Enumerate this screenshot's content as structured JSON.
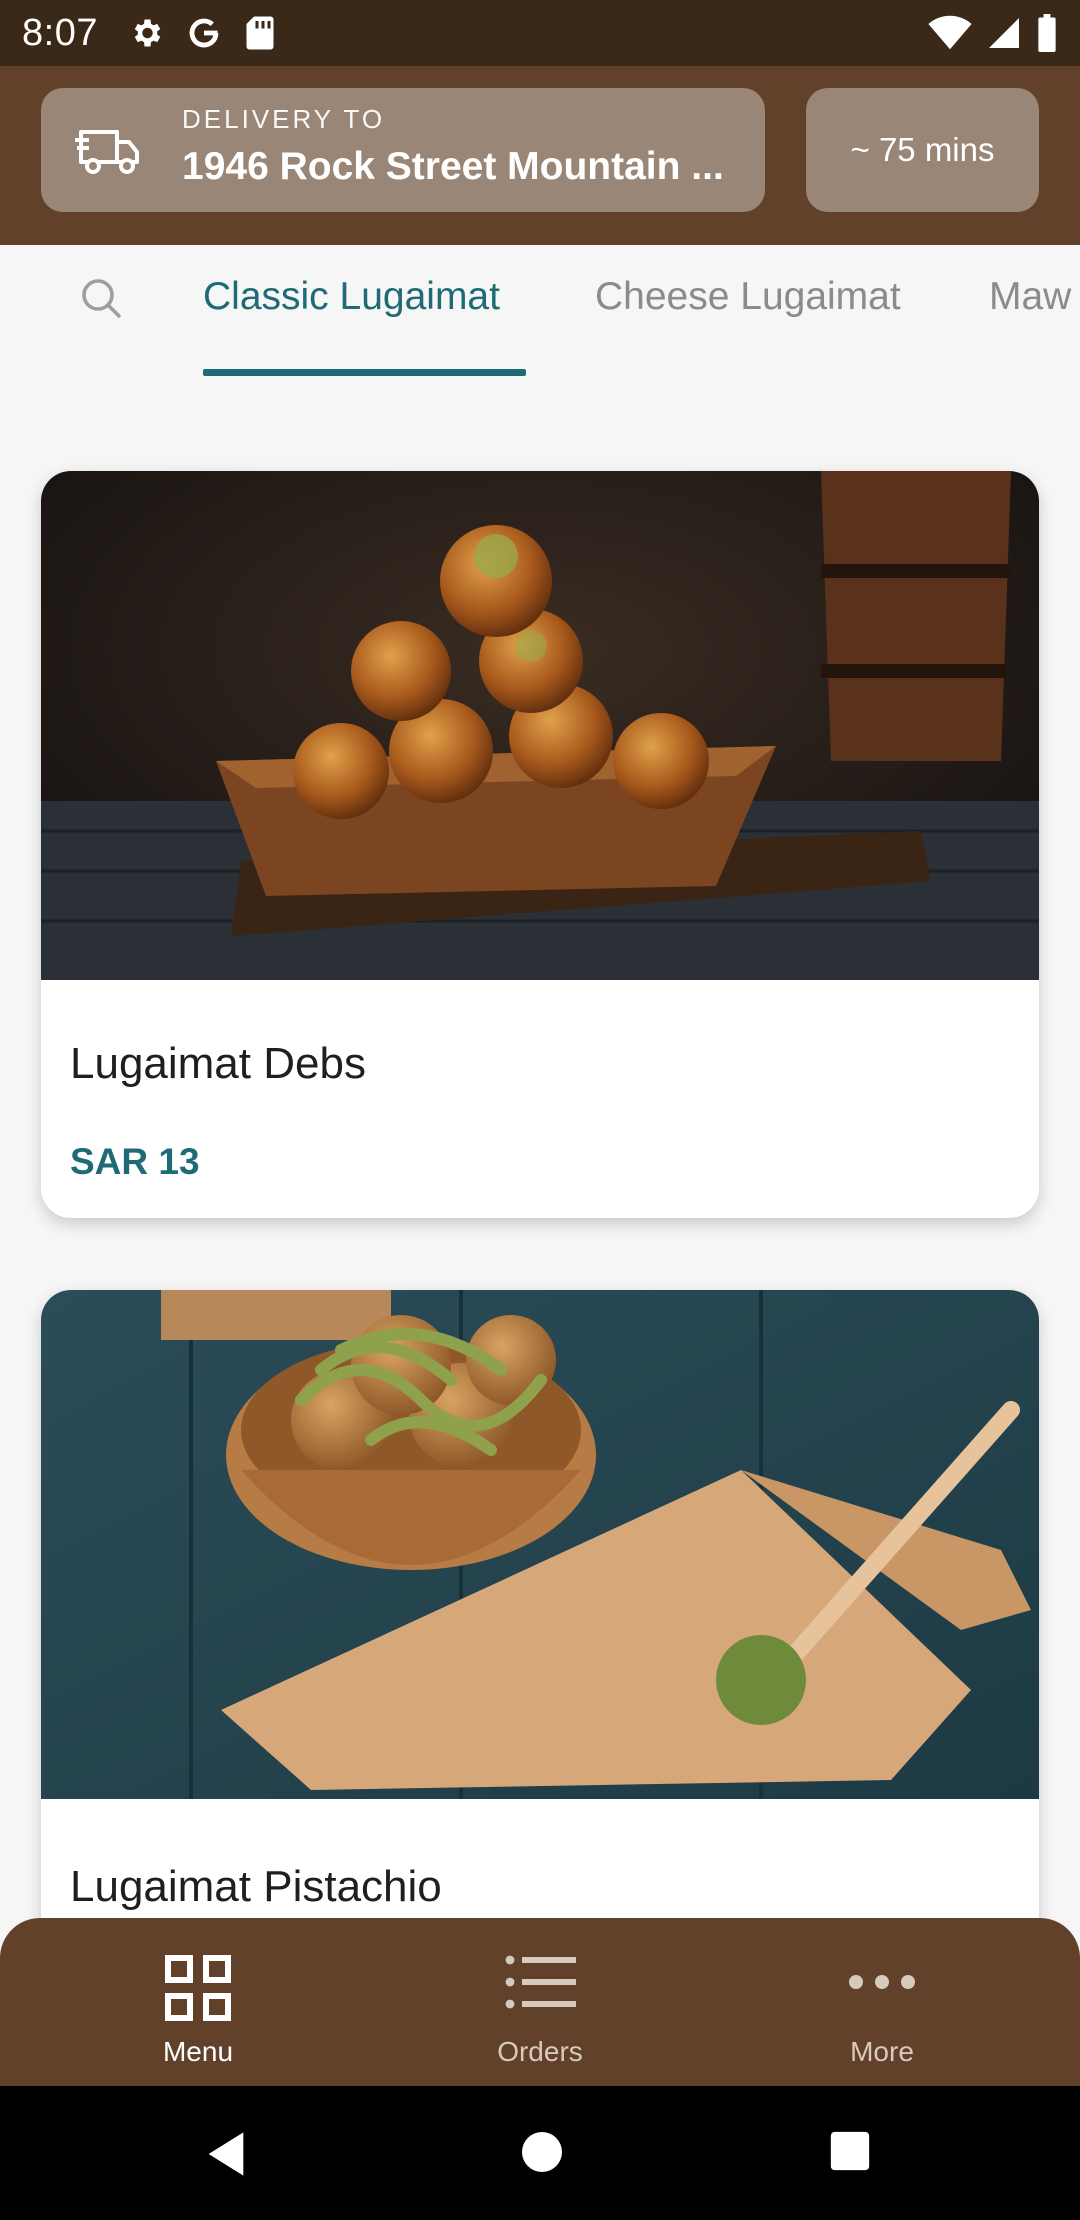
{
  "status_bar": {
    "time": "8:07",
    "icons": [
      "settings-gear-icon",
      "google-g-icon",
      "sd-card-icon",
      "wifi-icon",
      "signal-icon",
      "battery-icon"
    ]
  },
  "header": {
    "delivery_label": "DELIVERY TO",
    "delivery_address": "1946 Rock Street Mountain ...",
    "eta": "~ 75 mins",
    "icons": {
      "delivery": "truck-icon"
    }
  },
  "tabs": {
    "search_icon": "search-icon",
    "items": [
      {
        "label": "Classic Lugaimat",
        "active": true
      },
      {
        "label": "Cheese Lugaimat",
        "active": false
      },
      {
        "label": "Maw",
        "active": false
      }
    ]
  },
  "products": [
    {
      "name": "Lugaimat Debs",
      "price": "SAR 13",
      "image": "lugaimat-debs-photo"
    },
    {
      "name": "Lugaimat Pistachio",
      "price": "",
      "image": "lugaimat-pistachio-photo"
    }
  ],
  "bottom_nav": {
    "items": [
      {
        "label": "Menu",
        "icon": "grid-icon",
        "active": true
      },
      {
        "label": "Orders",
        "icon": "list-icon",
        "active": false
      },
      {
        "label": "More",
        "icon": "more-dots-icon",
        "active": false
      }
    ]
  },
  "system_nav": {
    "icons": [
      "back-icon",
      "home-icon",
      "recents-icon"
    ]
  },
  "colors": {
    "status_bar": "#3a2818",
    "header": "#62412a",
    "chip": "#9a8676",
    "accent": "#1e6b76",
    "background": "#f6f6f6"
  }
}
